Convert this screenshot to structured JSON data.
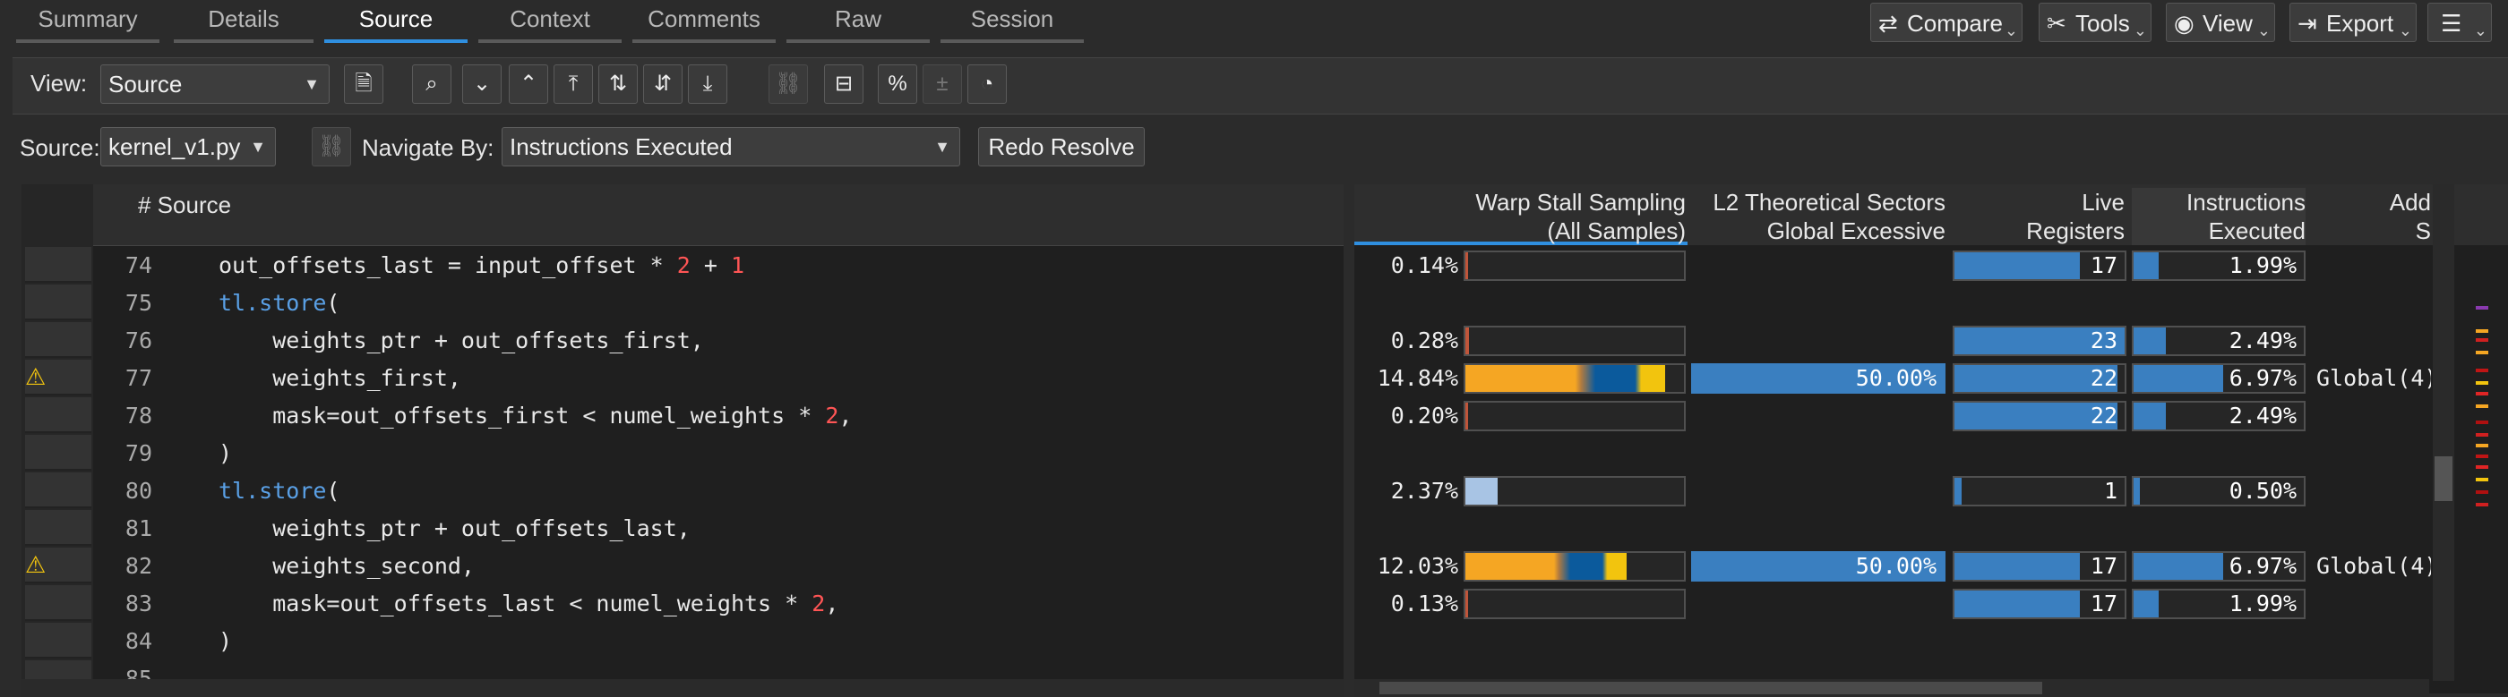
{
  "tabs": [
    "Summary",
    "Details",
    "Source",
    "Context",
    "Comments",
    "Raw",
    "Session"
  ],
  "toolbar_right": {
    "compare": "Compare",
    "tools": "Tools",
    "view": "View",
    "export": "Export"
  },
  "view_label": "View:",
  "view_value": "Source",
  "source_label": "Source:",
  "source_value": "kernel_v1.py",
  "navigate_label": "Navigate By:",
  "navigate_value": "Instructions Executed",
  "redo_label": "Redo Resolve",
  "source_header": "# Source",
  "col_warp": [
    "Warp Stall Sampling",
    "(All Samples)"
  ],
  "col_l2": [
    "L2 Theoretical Sectors",
    "Global Excessive"
  ],
  "col_live": [
    "Live",
    "Registers"
  ],
  "col_inst": [
    "Instructions",
    "Executed"
  ],
  "col_add": [
    "Add",
    "S"
  ],
  "lines": [
    {
      "n": "74",
      "code": "out_offsets_last = input_offset * 2 + 1",
      "warn": false,
      "warp": "0.14%",
      "l2": "",
      "live": "17",
      "inst": "1.99%",
      "addr": ""
    },
    {
      "n": "75",
      "code": "tl.store(",
      "warn": false,
      "warp": "",
      "l2": "",
      "live": "",
      "inst": "",
      "addr": ""
    },
    {
      "n": "76",
      "code": "    weights_ptr + out_offsets_first,",
      "warn": false,
      "warp": "0.28%",
      "l2": "",
      "live": "23",
      "inst": "2.49%",
      "addr": ""
    },
    {
      "n": "77",
      "code": "    weights_first,",
      "warn": true,
      "warp": "14.84%",
      "l2": "50.00%",
      "live": "22",
      "inst": "6.97%",
      "addr": "Global(4)"
    },
    {
      "n": "78",
      "code": "    mask=out_offsets_first < numel_weights * 2,",
      "warn": false,
      "warp": "0.20%",
      "l2": "",
      "live": "22",
      "inst": "2.49%",
      "addr": ""
    },
    {
      "n": "79",
      "code": ")",
      "warn": false,
      "warp": "",
      "l2": "",
      "live": "",
      "inst": "",
      "addr": ""
    },
    {
      "n": "80",
      "code": "tl.store(",
      "warn": false,
      "warp": "2.37%",
      "l2": "",
      "live": "1",
      "inst": "0.50%",
      "addr": ""
    },
    {
      "n": "81",
      "code": "    weights_ptr + out_offsets_last,",
      "warn": false,
      "warp": "",
      "l2": "",
      "live": "",
      "inst": "",
      "addr": ""
    },
    {
      "n": "82",
      "code": "    weights_second,",
      "warn": true,
      "warp": "12.03%",
      "l2": "50.00%",
      "live": "17",
      "inst": "6.97%",
      "addr": "Global(4)"
    },
    {
      "n": "83",
      "code": "    mask=out_offsets_last < numel_weights * 2,",
      "warn": false,
      "warp": "0.13%",
      "l2": "",
      "live": "17",
      "inst": "1.99%",
      "addr": ""
    },
    {
      "n": "84",
      "code": ")",
      "warn": false,
      "warp": "",
      "l2": "",
      "live": "",
      "inst": "",
      "addr": ""
    },
    {
      "n": "85",
      "code": "",
      "warn": false,
      "warp": "",
      "l2": "",
      "live": "",
      "inst": "",
      "addr": ""
    }
  ],
  "colors": {
    "accent": "#2f8fe0",
    "bar_blue": "#3a7fc0",
    "stall_orange": "#f5a623",
    "stall_dark_blue": "#0b5a9c",
    "stall_yellow": "#f2c40e",
    "warning": "#f2c40e",
    "keyword": "#5aa0e6",
    "number": "#ff5555"
  }
}
